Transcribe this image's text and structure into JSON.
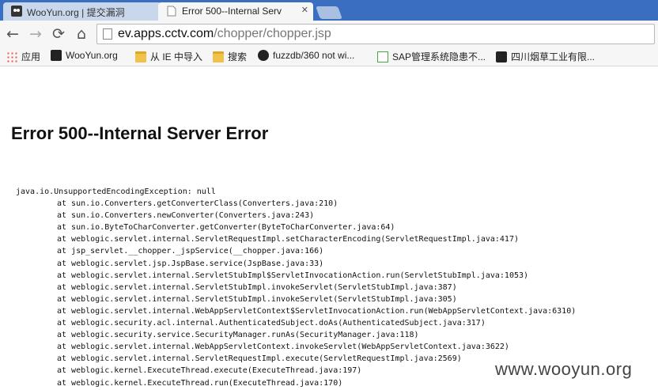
{
  "tabs": [
    {
      "title": "WooYun.org | 提交漏洞",
      "active": false
    },
    {
      "title": "Error 500--Internal Serv",
      "active": true
    }
  ],
  "toolbar": {
    "back_icon": "←",
    "forward_icon": "→",
    "reload_icon": "⟳",
    "home_icon": "⌂",
    "url_host": "ev.apps.cctv.com",
    "url_path": "/chopper/chopper.jsp"
  },
  "bookmarks": [
    {
      "label": "应用",
      "icon": "apps-icon"
    },
    {
      "label": "WooYun.org",
      "icon": "wooyun-icon"
    },
    {
      "label": "从 IE 中导入",
      "icon": "folder-icon"
    },
    {
      "label": "搜索",
      "icon": "folder-icon"
    },
    {
      "label": "fuzzdb/360 not wi...",
      "icon": "github-icon"
    },
    {
      "label": "SAP管理系统隐患不...",
      "icon": "sap-icon"
    },
    {
      "label": "四川烟草工业有限...",
      "icon": "wooyun-icon"
    }
  ],
  "page": {
    "title": "Error 500--Internal Server Error",
    "exception": "java.io.UnsupportedEncodingException: null",
    "stack": [
      "at sun.io.Converters.getConverterClass(Converters.java:210)",
      "at sun.io.Converters.newConverter(Converters.java:243)",
      "at sun.io.ByteToCharConverter.getConverter(ByteToCharConverter.java:64)",
      "at weblogic.servlet.internal.ServletRequestImpl.setCharacterEncoding(ServletRequestImpl.java:417)",
      "at jsp_servlet.__chopper._jspService(__chopper.java:166)",
      "at weblogic.servlet.jsp.JspBase.service(JspBase.java:33)",
      "at weblogic.servlet.internal.ServletStubImpl$ServletInvocationAction.run(ServletStubImpl.java:1053)",
      "at weblogic.servlet.internal.ServletStubImpl.invokeServlet(ServletStubImpl.java:387)",
      "at weblogic.servlet.internal.ServletStubImpl.invokeServlet(ServletStubImpl.java:305)",
      "at weblogic.servlet.internal.WebAppServletContext$ServletInvocationAction.run(WebAppServletContext.java:6310)",
      "at weblogic.security.acl.internal.AuthenticatedSubject.doAs(AuthenticatedSubject.java:317)",
      "at weblogic.security.service.SecurityManager.runAs(SecurityManager.java:118)",
      "at weblogic.servlet.internal.WebAppServletContext.invokeServlet(WebAppServletContext.java:3622)",
      "at weblogic.servlet.internal.ServletRequestImpl.execute(ServletRequestImpl.java:2569)",
      "at weblogic.kernel.ExecuteThread.execute(ExecuteThread.java:197)",
      "at weblogic.kernel.ExecuteThread.run(ExecuteThread.java:170)"
    ]
  },
  "watermark": "www.wooyun.org",
  "colors": {
    "tabstrip": "#3a6fbf",
    "toolbar": "#f6f6f6"
  }
}
